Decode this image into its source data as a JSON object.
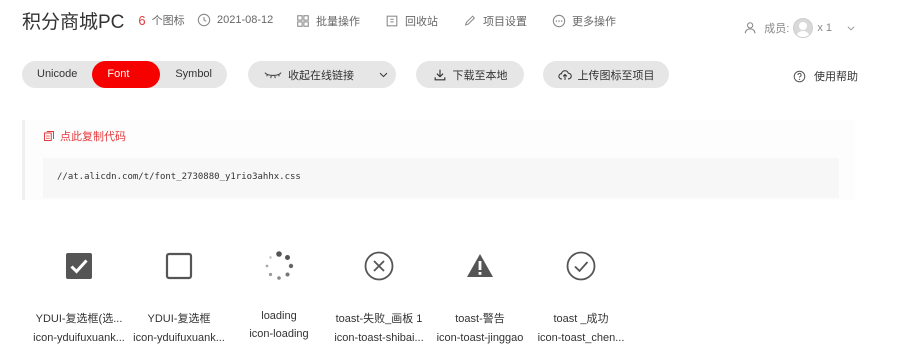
{
  "header": {
    "project_title": "积分商城PC",
    "icon_count": "6",
    "icon_count_label": "个图标",
    "date": "2021-08-12",
    "batch_ops": "批量操作",
    "recycle_bin": "回收站",
    "project_settings": "项目设置",
    "more_ops": "更多操作",
    "members_label": "成员:",
    "members_count": "x 1"
  },
  "toolbar": {
    "tabs": [
      "Unicode",
      "Font class",
      "Symbol"
    ],
    "active_tab": "Font class",
    "collapse_link": "收起在线链接",
    "download": "下载至本地",
    "upload": "上传图标至项目",
    "help": "使用帮助"
  },
  "code_panel": {
    "copy_label": "点此复制代码",
    "url": "//at.alicdn.com/t/font_2730880_y1rio3ahhx.css"
  },
  "icons": [
    {
      "name": "YDUI-复选框(选...",
      "code": "icon-yduifuxuank...",
      "icon": "checkbox-checked-icon"
    },
    {
      "name": "YDUI-复选框",
      "code": "icon-yduifuxuank...",
      "icon": "checkbox-icon"
    },
    {
      "name": "loading",
      "code": "icon-loading",
      "icon": "loading-icon"
    },
    {
      "name": "toast-失败_画板 1",
      "code": "icon-toast-shibai...",
      "icon": "toast-fail-icon"
    },
    {
      "name": "toast-警告",
      "code": "icon-toast-jinggao",
      "icon": "toast-warning-icon"
    },
    {
      "name": "toast _成功",
      "code": "icon-toast_chen...",
      "icon": "toast-success-icon"
    }
  ],
  "colors": {
    "accent": "#f70000",
    "link_red": "#e4393c",
    "pill_bg": "#e6e6e6",
    "icon_gray": "#555555"
  }
}
